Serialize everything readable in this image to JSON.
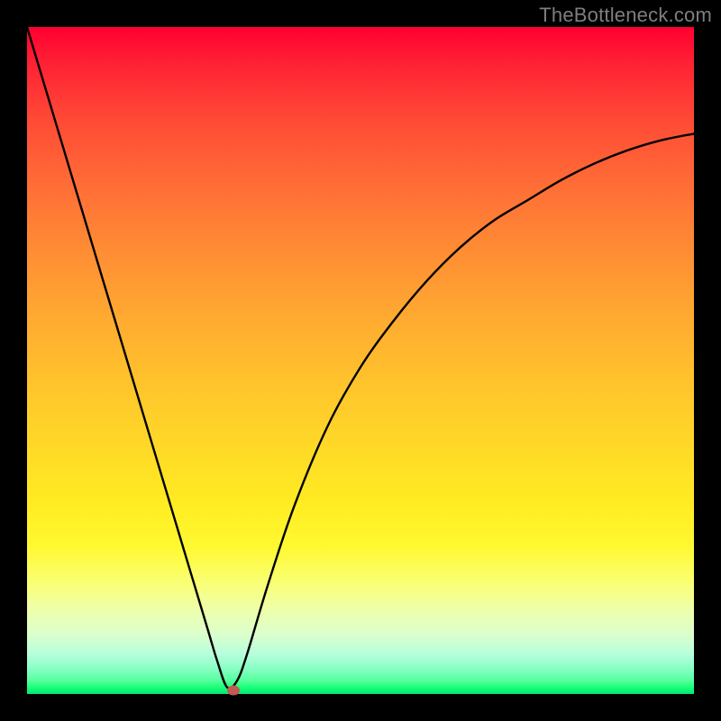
{
  "watermark": "TheBottleneck.com",
  "colors": {
    "frame_bg_top": "#ff0030",
    "frame_bg_bottom": "#00e875",
    "curve": "#000000",
    "dot": "#c25b53",
    "page_bg": "#000000",
    "watermark": "#7e7e7e"
  },
  "chart_data": {
    "type": "line",
    "title": "",
    "xlabel": "",
    "ylabel": "",
    "xlim": [
      0,
      100
    ],
    "ylim": [
      0,
      100
    ],
    "series": [
      {
        "name": "curve",
        "x": [
          0,
          3,
          6,
          9,
          12,
          15,
          18,
          21,
          24,
          27,
          28.5,
          30,
          31.5,
          33,
          36,
          40,
          45,
          50,
          55,
          60,
          65,
          70,
          75,
          80,
          85,
          90,
          95,
          100
        ],
        "y": [
          100,
          90,
          80,
          70,
          60,
          50,
          40,
          30,
          20,
          10,
          5,
          1,
          2,
          6,
          16,
          28,
          40,
          49,
          56,
          62,
          67,
          71,
          74,
          77,
          79.5,
          81.5,
          83,
          84
        ]
      }
    ],
    "marker": {
      "x": 31,
      "y": 0.6
    },
    "notes": "Axes unlabeled in source image; x and y values are estimated on a 0–100 normalized scale from visual gridless reading. Curve is a V-shaped profile with minimum near x≈30."
  }
}
